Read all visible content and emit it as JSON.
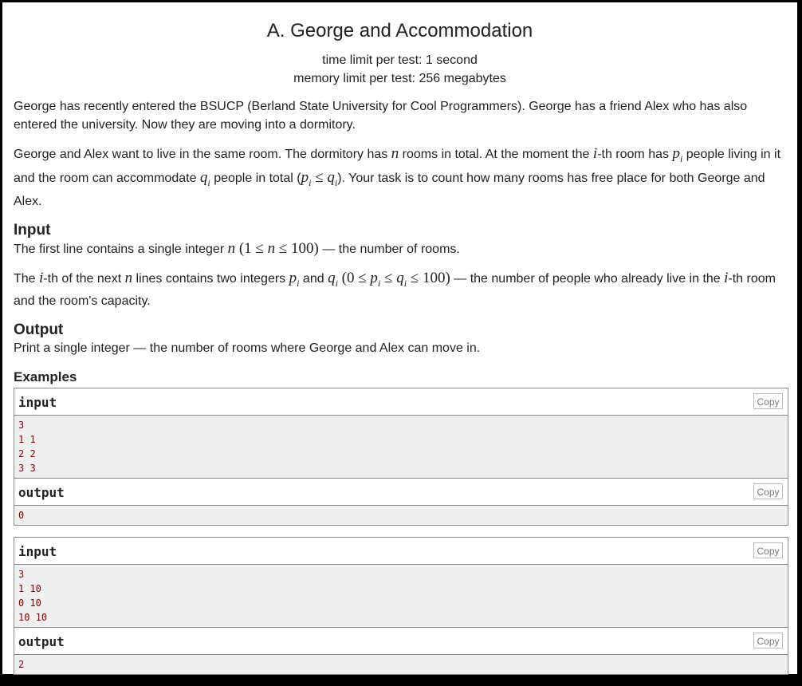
{
  "problem": {
    "title": "A. George and Accommodation",
    "time_limit": "time limit per test: 1 second",
    "memory_limit": "memory limit per test: 256 megabytes"
  },
  "statement": {
    "p1": "George has recently entered the BSUCP (Berland State University for Cool Programmers). George has a friend Alex who has also entered the university. Now they are moving into a dormitory.",
    "p2_a": "George and Alex want to live in the same room. The dormitory has ",
    "p2_b": " rooms in total. At the moment the ",
    "p2_c": "-th room has ",
    "p2_d": " people living in it and the room can accommodate ",
    "p2_e": " people in total (",
    "p2_f": "). Your task is to count how many rooms has free place for both George and Alex."
  },
  "input_section": {
    "title": "Input",
    "l1_a": "The first line contains a single integer ",
    "l1_b": " — the number of rooms.",
    "l2_a": "The ",
    "l2_b": "-th of the next ",
    "l2_c": " lines contains two integers ",
    "l2_d": " and ",
    "l2_e": " — the number of people who already live in the ",
    "l2_f": "-th room and the room's capacity."
  },
  "output_section": {
    "title": "Output",
    "text": "Print a single integer — the number of rooms where George and Alex can move in."
  },
  "examples": {
    "title": "Examples",
    "copy_label": "Copy",
    "input_label": "input",
    "output_label": "output",
    "items": [
      {
        "input": "3\n1 1\n2 2\n3 3",
        "output": "0"
      },
      {
        "input": "3\n1 10\n0 10\n10 10",
        "output": "2"
      }
    ]
  }
}
